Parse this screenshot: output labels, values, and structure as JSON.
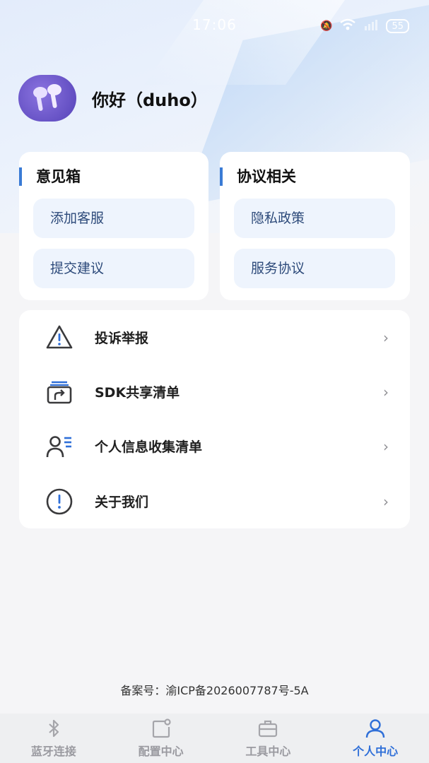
{
  "status_bar": {
    "time": "17:06",
    "battery": "55"
  },
  "profile": {
    "greeting": "你好（duho）"
  },
  "feedback_card": {
    "title": "意见箱",
    "items": [
      {
        "label": "添加客服"
      },
      {
        "label": "提交建议"
      }
    ]
  },
  "agreement_card": {
    "title": "协议相关",
    "items": [
      {
        "label": "隐私政策"
      },
      {
        "label": "服务协议"
      }
    ]
  },
  "menu": {
    "items": [
      {
        "label": "投诉举报",
        "icon": "warning-icon"
      },
      {
        "label": "SDK共享清单",
        "icon": "share-list-icon"
      },
      {
        "label": "个人信息收集清单",
        "icon": "user-list-icon"
      },
      {
        "label": "关于我们",
        "icon": "info-icon"
      }
    ]
  },
  "footer": {
    "record": "备案号：渝ICP备2026007787号-5A"
  },
  "tabbar": {
    "tabs": [
      {
        "label": "蓝牙连接",
        "icon": "bluetooth-icon",
        "active": false
      },
      {
        "label": "配置中心",
        "icon": "config-icon",
        "active": false
      },
      {
        "label": "工具中心",
        "icon": "toolbox-icon",
        "active": false
      },
      {
        "label": "个人中心",
        "icon": "person-icon",
        "active": true
      }
    ]
  },
  "colors": {
    "accent": "#2f6fd8",
    "pill_bg": "#eef4fd",
    "pill_text": "#2d4a7a"
  }
}
